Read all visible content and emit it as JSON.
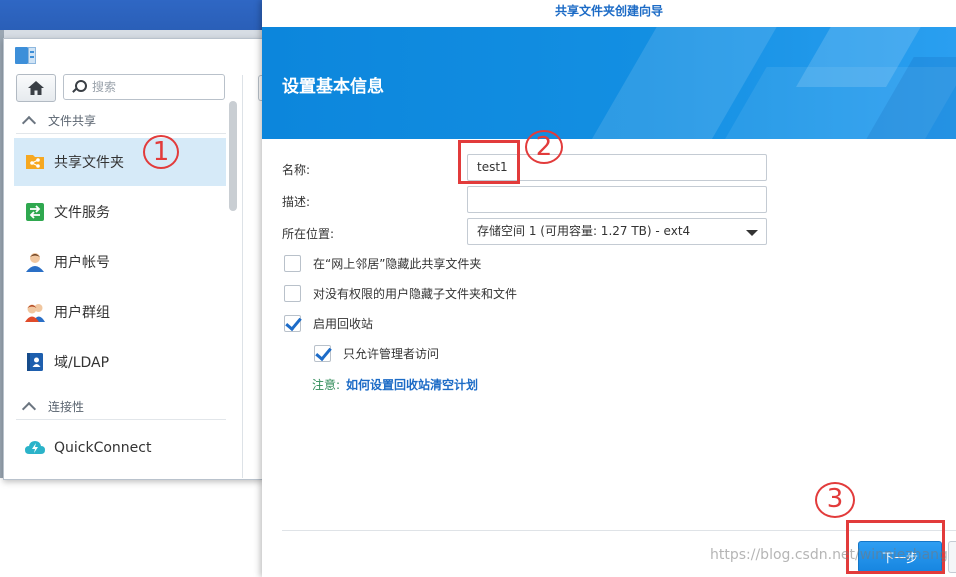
{
  "control_panel": {
    "search": {
      "placeholder": "搜索"
    },
    "sections": [
      {
        "label": "文件共享",
        "items": [
          "共享文件夹",
          "文件服务",
          "用户帐号",
          "用户群组",
          "域/LDAP"
        ]
      },
      {
        "label": "连接性",
        "items": [
          "QuickConnect"
        ]
      }
    ],
    "active_item": "共享文件夹"
  },
  "wizard": {
    "title": "共享文件夹创建向导",
    "banner_title": "设置基本信息",
    "fields": {
      "name": {
        "label": "名称:",
        "value": "test1"
      },
      "description": {
        "label": "描述:",
        "value": ""
      },
      "location": {
        "label": "所在位置:",
        "value": "存储空间 1 (可用容量:  1.27 TB) - ext4"
      }
    },
    "checkboxes": [
      {
        "label": "在“网上邻居”隐藏此共享文件夹",
        "checked": false
      },
      {
        "label": "对没有权限的用户隐藏子文件夹和文件",
        "checked": false
      },
      {
        "label": "启用回收站",
        "checked": true
      },
      {
        "label": "只允许管理者访问",
        "checked": true
      }
    ],
    "note": {
      "label": "注意:",
      "link": "如何设置回收站清空计划"
    },
    "next_button": "下一步"
  },
  "annotations": [
    "1",
    "2",
    "3"
  ],
  "watermark": "https://blog.csdn.net/winniezhang",
  "colors": {
    "accent": "#1c6bc6",
    "banner": "#138fe2",
    "annotation": "#e23b3b",
    "active_row": "#d6eaf8"
  }
}
